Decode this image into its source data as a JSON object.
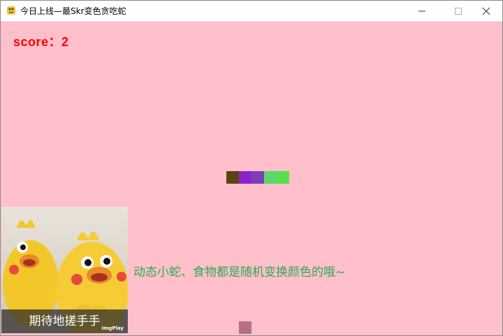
{
  "window": {
    "title": "今日上线—最Skr变色贪吃蛇",
    "icon": "python-snake-icon"
  },
  "controls": {
    "minimize_icon": "minimize-icon",
    "maximize_icon": "maximize-icon",
    "close_icon": "close-icon"
  },
  "game": {
    "background_color": "#ffc0cb",
    "score_text": "score：2",
    "score_color": "#ff0000",
    "snake": {
      "segment_colors": [
        "#5a4510",
        "#8e22c8",
        "#7b3db8",
        "#5bd86a",
        "#55e04a"
      ]
    },
    "food": {
      "color": "#b57083"
    },
    "hint_text": "动态小蛇、食物都是随机变换颜色的哦~",
    "hint_color": "#2fa84f",
    "meme": {
      "caption": "期待地搓手手",
      "watermark": "ImgPlay"
    }
  }
}
